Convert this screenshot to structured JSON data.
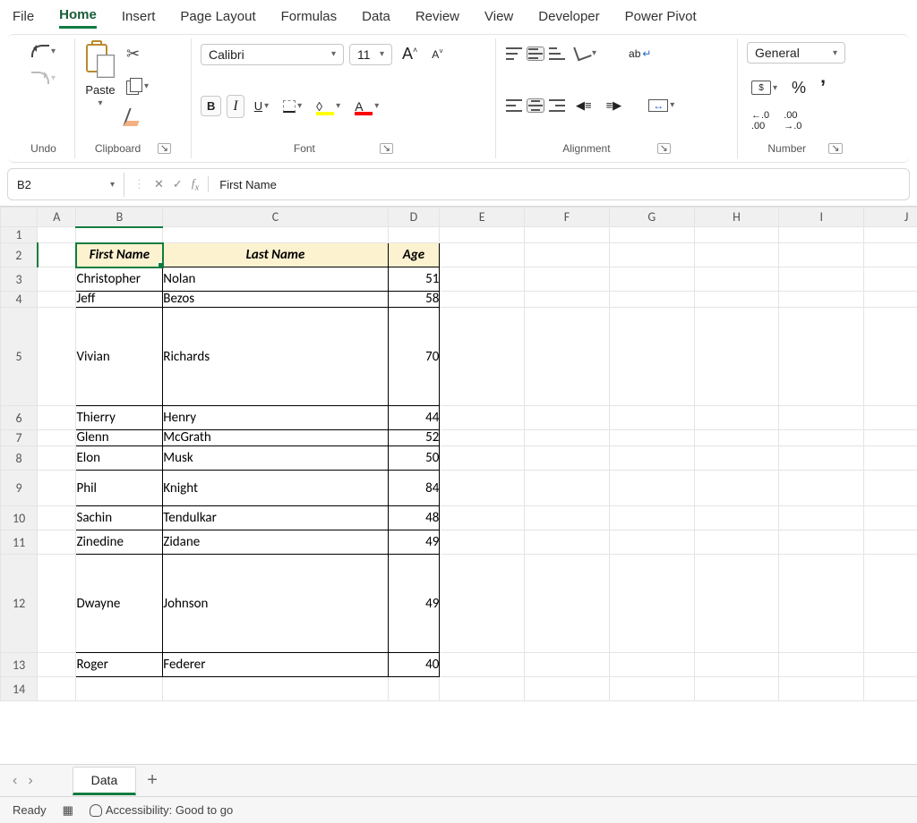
{
  "tabs": {
    "file": "File",
    "home": "Home",
    "insert": "Insert",
    "page_layout": "Page Layout",
    "formulas": "Formulas",
    "data": "Data",
    "review": "Review",
    "view": "View",
    "developer": "Developer",
    "power_pivot": "Power Pivot"
  },
  "ribbon": {
    "undo_label": "Undo",
    "clipboard": {
      "paste": "Paste",
      "label": "Clipboard"
    },
    "font": {
      "name": "Calibri",
      "size": "11",
      "label": "Font"
    },
    "alignment": {
      "label": "Alignment"
    },
    "number": {
      "format": "General",
      "label": "Number",
      "inc": "←.0\n.00",
      "dec": ".00\n→.0"
    }
  },
  "namebox": "B2",
  "formula": "First Name",
  "columns": [
    "A",
    "B",
    "C",
    "D",
    "E",
    "F",
    "G",
    "H",
    "I",
    "J"
  ],
  "rows": [
    "1",
    "2",
    "3",
    "4",
    "5",
    "6",
    "7",
    "8",
    "9",
    "10",
    "11",
    "12",
    "13",
    "14"
  ],
  "row_heights": {
    "1": "short",
    "4": "short",
    "5": "tall",
    "7": "short",
    "9": "med",
    "12": "tall"
  },
  "headers": {
    "b": "First Name",
    "c": "Last Name",
    "d": "Age"
  },
  "data": [
    {
      "first": "Christopher",
      "last": "Nolan",
      "age": "51"
    },
    {
      "first": "Jeff",
      "last": "Bezos",
      "age": "58"
    },
    {
      "first": "Vivian",
      "last": "Richards",
      "age": "70"
    },
    {
      "first": "Thierry",
      "last": "Henry",
      "age": "44"
    },
    {
      "first": "Glenn",
      "last": "McGrath",
      "age": "52"
    },
    {
      "first": "Elon",
      "last": "Musk",
      "age": "50"
    },
    {
      "first": "Phil",
      "last": "Knight",
      "age": "84"
    },
    {
      "first": "Sachin",
      "last": "Tendulkar",
      "age": "48"
    },
    {
      "first": "Zinedine",
      "last": "Zidane",
      "age": "49"
    },
    {
      "first": "Dwayne",
      "last": "Johnson",
      "age": "49"
    },
    {
      "first": "Roger",
      "last": "Federer",
      "age": "40"
    }
  ],
  "sheet": {
    "name": "Data"
  },
  "status": {
    "ready": "Ready",
    "accessibility": "Accessibility: Good to go"
  }
}
